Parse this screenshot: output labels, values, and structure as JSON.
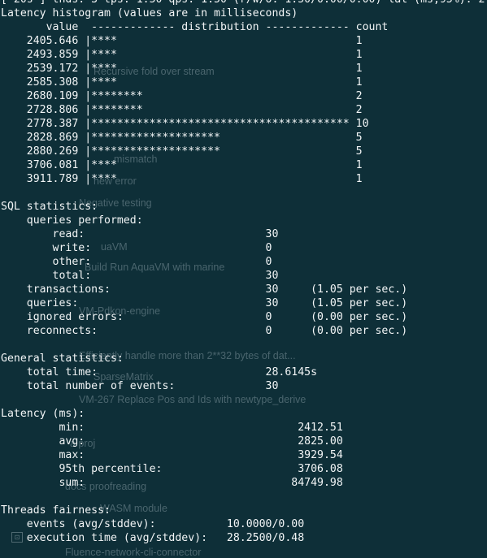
{
  "colors": {
    "background": "#0e2f38",
    "foreground": "#f2f5f6",
    "ghost_text": "rgba(200,215,220,0.32)"
  },
  "ghost_icon_name": "window-icon",
  "ghost_items": [
    {
      "text": "Recursive fold over stream"
    },
    {
      "text": "mismatch"
    },
    {
      "text": "new error"
    },
    {
      "text": "Negative testing"
    },
    {
      "text": "uaVM"
    },
    {
      "text": "Build Run AquaVM with marine"
    },
    {
      "text": "VM-Pdkon-engine"
    },
    {
      "text": "Efficiently handle more than 2**32 bytes of dat..."
    },
    {
      "text": "SparseMatrix"
    },
    {
      "text": "VM-267 Replace Pos and Ids with newtype_derive"
    },
    {
      "text": "a proj"
    },
    {
      "text": "docs proofreading"
    },
    {
      "text": "WASM module"
    },
    {
      "text": "Fluence-network-cli-connector"
    }
  ],
  "terminal_lines": [
    "[ 20s ] thds: 3 tps: 1.50 qps: 1.50 (r/w/o: 1.50/0.00/0.00) lat (ms,95%): 2",
    "Latency histogram (values are in milliseconds)",
    "       value  ------------- distribution ------------- count",
    "    2405.646 |****                                     1",
    "    2493.859 |****                                     1",
    "    2539.172 |****                                     1",
    "    2585.308 |****                                     1",
    "    2680.109 |********                                 2",
    "    2728.806 |********                                 2",
    "    2778.387 |**************************************** 10",
    "    2828.869 |********************                     5",
    "    2880.269 |********************                     5",
    "    3706.081 |****                                     1",
    "    3911.789 |****                                     1",
    "",
    "SQL statistics:",
    "    queries performed:",
    "        read:                            30",
    "        write:                           0",
    "        other:                           0",
    "        total:                           30",
    "    transactions:                        30     (1.05 per sec.)",
    "    queries:                             30     (1.05 per sec.)",
    "    ignored errors:                      0      (0.00 per sec.)",
    "    reconnects:                          0      (0.00 per sec.)",
    "",
    "General statistics:",
    "    total time:                          28.6145s",
    "    total number of events:              30",
    "",
    "Latency (ms):",
    "         min:                                 2412.51",
    "         avg:                                 2825.00",
    "         max:                                 3929.54",
    "         95th percentile:                     3706.08",
    "         sum:                                84749.98",
    "",
    "Threads fairness:",
    "    events (avg/stddev):           10.0000/0.00",
    "    execution time (avg/stddev):   28.2500/0.48"
  ]
}
